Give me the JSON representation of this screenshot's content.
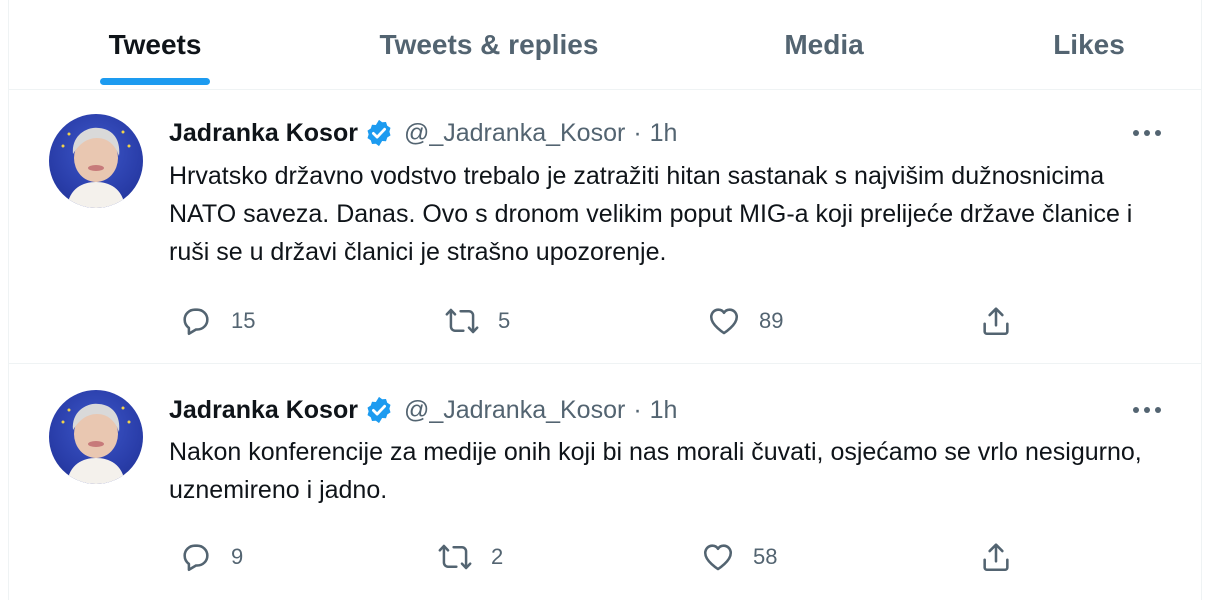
{
  "tabs": [
    {
      "label": "Tweets",
      "active": true
    },
    {
      "label": "Tweets & replies",
      "active": false
    },
    {
      "label": "Media",
      "active": false
    },
    {
      "label": "Likes",
      "active": false
    }
  ],
  "colors": {
    "accent": "#1d9bf0",
    "text_primary": "#0f1419",
    "text_secondary": "#536471",
    "divider": "#eff3f4"
  },
  "tweets": [
    {
      "display_name": "Jadranka Kosor",
      "verified_icon": "verified-badge-icon",
      "handle": "@_Jadranka_Kosor",
      "separator": "·",
      "time": "1h",
      "text": "Hrvatsko državno vodstvo trebalo je zatražiti hitan sastanak s najvišim dužnosnicima NATO saveza. Danas. Ovo s dronom velikim poput MIG-a koji prelijeće države članice i ruši se u državi članici je strašno upozorenje.",
      "replies": "15",
      "retweets": "5",
      "likes": "89"
    },
    {
      "display_name": "Jadranka Kosor",
      "verified_icon": "verified-badge-icon",
      "handle": "@_Jadranka_Kosor",
      "separator": "·",
      "time": "1h",
      "text": "Nakon konferencije za medije onih koji bi nas morali čuvati, osjećamo se vrlo nesigurno, uznemireno i jadno.",
      "replies": "9",
      "retweets": "2",
      "likes": "58"
    }
  ]
}
